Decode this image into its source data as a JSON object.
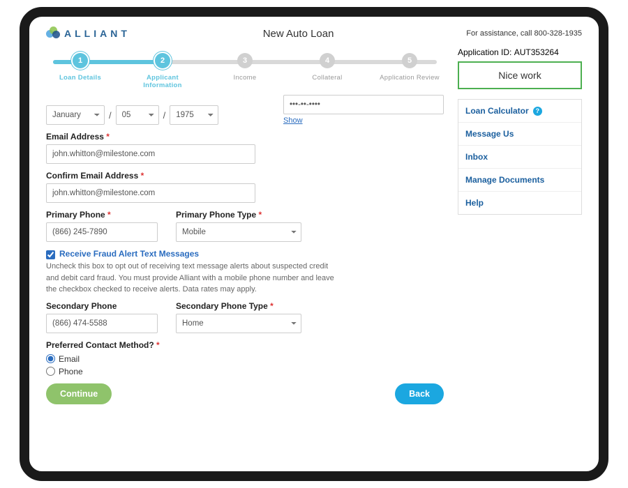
{
  "header": {
    "brand": "ALLIANT",
    "title": "New Auto Loan",
    "assist_prefix": "For assistance, call ",
    "assist_phone": "800-328-1935"
  },
  "stepper": {
    "steps": [
      {
        "num": "1",
        "label": "Loan Details",
        "state": "done"
      },
      {
        "num": "2",
        "label": "Applicant Information",
        "state": "active"
      },
      {
        "num": "3",
        "label": "Income",
        "state": "todo"
      },
      {
        "num": "4",
        "label": "Collateral",
        "state": "todo"
      },
      {
        "num": "5",
        "label": "Application Review",
        "state": "todo"
      }
    ],
    "fill_percent": 28
  },
  "form": {
    "dob": {
      "month": "January",
      "day": "05",
      "year": "1975",
      "sep": "/"
    },
    "ssn": {
      "masked": "•••-••-••••",
      "show_label": "Show"
    },
    "email": {
      "label": "Email Address",
      "value": "john.whitton@milestone.com"
    },
    "confirm_email": {
      "label": "Confirm Email Address",
      "value": "john.whitton@milestone.com"
    },
    "primary_phone": {
      "label": "Primary Phone",
      "value": "(866) 245-7890"
    },
    "primary_phone_type": {
      "label": "Primary Phone Type",
      "value": "Mobile"
    },
    "fraud_alert": {
      "checked": true,
      "label": "Receive Fraud Alert Text Messages",
      "helper": "Uncheck this box to opt out of receiving text message alerts about suspected credit and debit card fraud. You must provide Alliant with a mobile phone number and leave the checkbox checked to receive alerts. Data rates may apply."
    },
    "secondary_phone": {
      "label": "Secondary Phone",
      "value": "(866) 474-5588"
    },
    "secondary_phone_type": {
      "label": "Secondary Phone Type",
      "value": "Home"
    },
    "contact_method": {
      "label": "Preferred Contact Method?",
      "options": [
        "Email",
        "Phone"
      ],
      "selected": "Email"
    },
    "buttons": {
      "continue": "Continue",
      "back": "Back"
    }
  },
  "sidebar": {
    "app_id_label": "Application ID:",
    "app_id_value": "AUT353264",
    "banner": "Nice work",
    "links": [
      "Loan Calculator",
      "Message Us",
      "Inbox",
      "Manage Documents",
      "Help"
    ]
  }
}
